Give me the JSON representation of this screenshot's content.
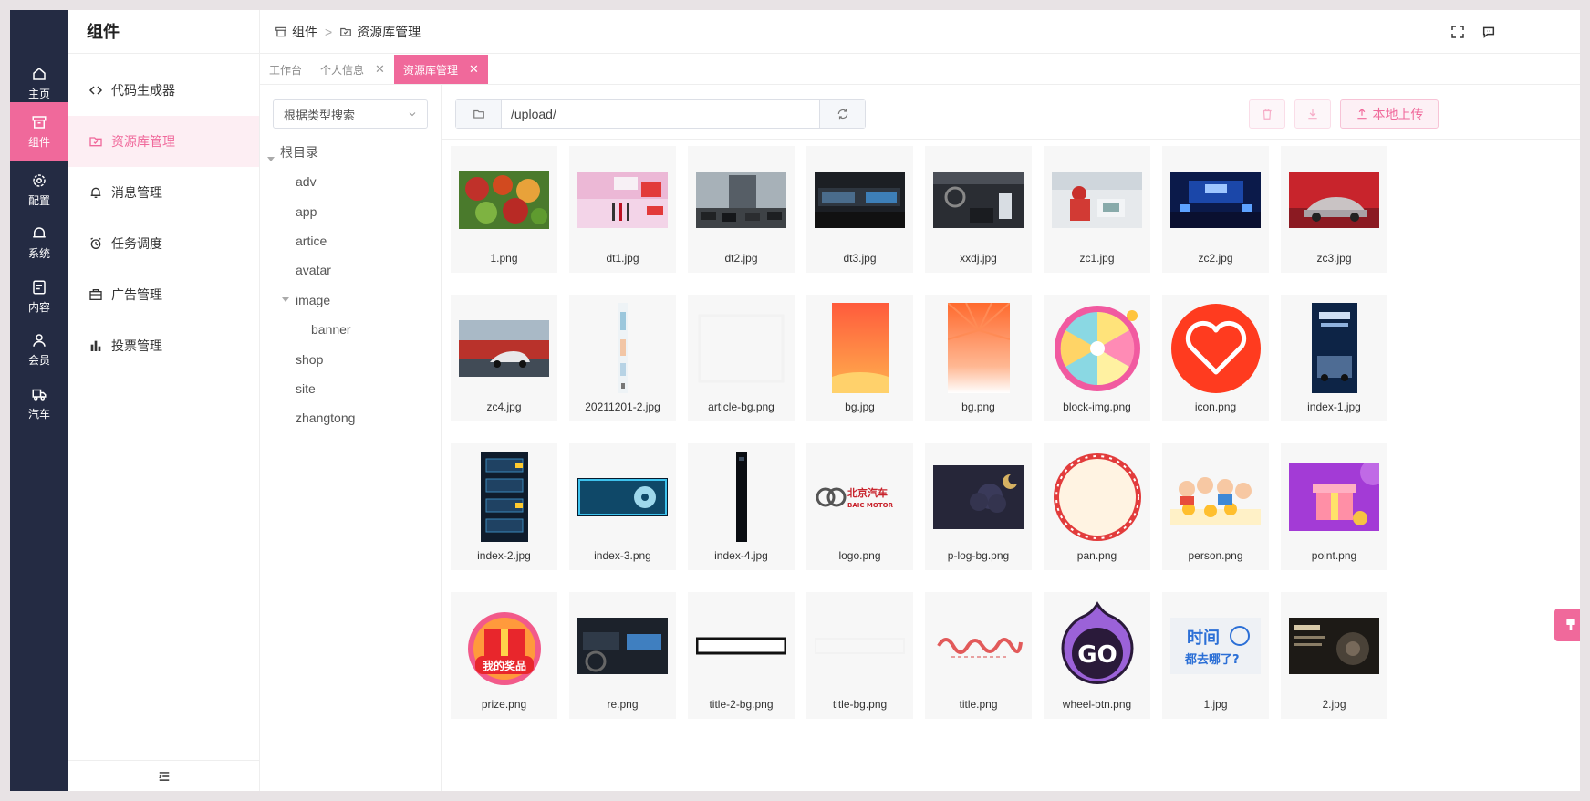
{
  "rail": {
    "items": [
      {
        "label": "主页",
        "icon": "home-icon"
      },
      {
        "label": "组件",
        "icon": "box-icon",
        "active": true
      },
      {
        "label": "配置",
        "icon": "gear-icon"
      },
      {
        "label": "系统",
        "icon": "bell-icon"
      },
      {
        "label": "内容",
        "icon": "document-icon"
      },
      {
        "label": "会员",
        "icon": "user-icon"
      },
      {
        "label": "汽车",
        "icon": "truck-icon"
      }
    ]
  },
  "menu": {
    "title": "组件",
    "items": [
      {
        "label": "代码生成器",
        "icon": "code-icon"
      },
      {
        "label": "资源库管理",
        "icon": "folder-check-icon",
        "active": true
      },
      {
        "label": "消息管理",
        "icon": "bell-icon"
      },
      {
        "label": "任务调度",
        "icon": "alarm-clock-icon"
      },
      {
        "label": "广告管理",
        "icon": "briefcase-icon"
      },
      {
        "label": "投票管理",
        "icon": "bar-chart-icon"
      }
    ]
  },
  "breadcrumb": {
    "parent": "组件",
    "current": "资源库管理"
  },
  "tabs": [
    {
      "label": "工作台",
      "closable": false
    },
    {
      "label": "个人信息",
      "closable": true
    },
    {
      "label": "资源库管理",
      "closable": true,
      "active": true
    }
  ],
  "tree": {
    "select_placeholder": "根据类型搜索",
    "root": "根目录",
    "nodes": [
      "adv",
      "app",
      "artice",
      "avatar",
      "image",
      "banner",
      "shop",
      "site",
      "zhangtong"
    ]
  },
  "toolbar": {
    "path": "/upload/",
    "upload_label": "本地上传"
  },
  "files": [
    "1.png",
    "dt1.jpg",
    "dt2.jpg",
    "dt3.jpg",
    "xxdj.jpg",
    "zc1.jpg",
    "zc2.jpg",
    "zc3.jpg",
    "zc4.jpg",
    "20211201-2.jpg",
    "article-bg.png",
    "bg.jpg",
    "bg.png",
    "block-img.png",
    "icon.png",
    "index-1.jpg",
    "index-2.jpg",
    "index-3.png",
    "index-4.jpg",
    "logo.png",
    "p-log-bg.png",
    "pan.png",
    "person.png",
    "point.png",
    "prize.png",
    "re.png",
    "title-2-bg.png",
    "title-bg.png",
    "title.png",
    "wheel-btn.png",
    "1.jpg",
    "2.jpg"
  ],
  "image_text": {
    "logo_cn": "北京汽车",
    "logo_en": "BAIC MOTOR",
    "prize": "我的奖品",
    "go": "GO",
    "time1": "时间",
    "time2": "都去哪了?"
  },
  "colors": {
    "accent": "#f0699b",
    "sidebar": "#242b43",
    "accent_light": "#fdeef3"
  }
}
